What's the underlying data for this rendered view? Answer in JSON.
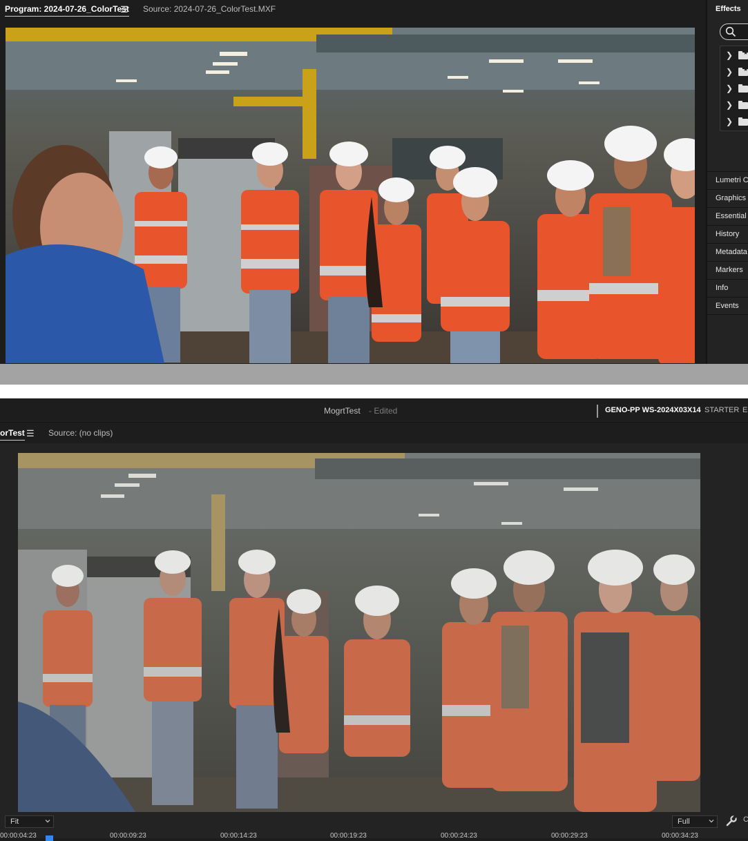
{
  "program_monitor_top": {
    "program_tab": "Program: 2024-07-26_ColorTest",
    "source_tab": "Source: 2024-07-26_ColorTest.MXF"
  },
  "effects_panel": {
    "title": "Effects",
    "search_placeholder": "",
    "tree_items": [
      "preset-bin",
      "preset-bin",
      "folder",
      "folder",
      "folder"
    ]
  },
  "panels": [
    "Lumetri C",
    "Graphics T",
    "Essential S",
    "History",
    "Metadata",
    "Markers",
    "Info",
    "Events"
  ],
  "header": {
    "project_name": "MogrtTest",
    "status": "- Edited",
    "workspace_active": "GENO-PP WS-2024X03X14",
    "workspace_starter": "STARTER",
    "workspace_more": "ES"
  },
  "program_monitor_bottom": {
    "program_tab": "orTest",
    "source_tab": "Source: (no clips)"
  },
  "controls": {
    "zoom": "Fit",
    "resolution": "Full",
    "trailing": "C"
  },
  "timecodes": [
    "00:00:04:23",
    "00:00:09:23",
    "00:00:14:23",
    "00:00:19:23",
    "00:00:24:23",
    "00:00:29:23",
    "00:00:34:23"
  ]
}
